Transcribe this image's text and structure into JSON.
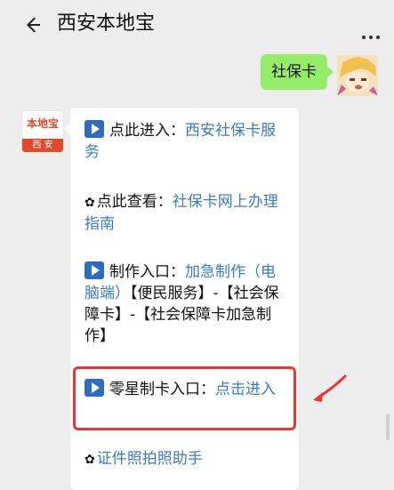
{
  "header": {
    "title": "西安本地宝",
    "back_icon": "back-arrow-icon",
    "more_icon": "more-dots-icon"
  },
  "chat": {
    "user_message": "社保卡",
    "bot_avatar": {
      "top_text": "本地宝",
      "bottom_text": "西 安"
    },
    "bot_lines": [
      {
        "icon": "play-icon",
        "prefix": "点此进入：",
        "link": "西安社保卡服务"
      },
      {
        "icon": "flower-icon",
        "prefix": "点此查看：",
        "link": "社保卡网上办理指南"
      },
      {
        "icon": "play-icon",
        "prefix": "制作入口：",
        "link": "加急制作（电脑端）",
        "suffix": "【便民服务】-【社会保障卡】-【社会保障卡加急制作】"
      },
      {
        "icon": "play-icon",
        "prefix": "零星制卡入口：",
        "link": "点击进入"
      },
      {
        "icon": "flower-icon",
        "link": "证件照拍照助手"
      }
    ]
  },
  "colors": {
    "accent_link": "#3b7bc2",
    "user_bubble": "#95ec69",
    "highlight": "#e33333"
  }
}
